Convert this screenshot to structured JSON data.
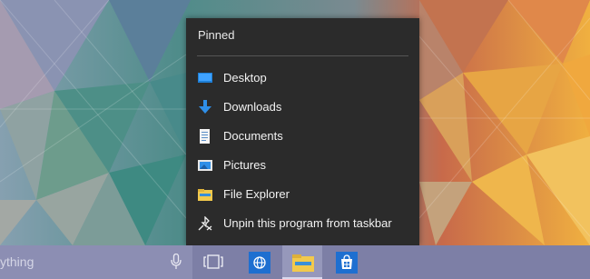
{
  "jumplist": {
    "header": "Pinned",
    "items": [
      {
        "label": "Desktop",
        "icon": "desktop-icon"
      },
      {
        "label": "Downloads",
        "icon": "downloads-icon"
      },
      {
        "label": "Documents",
        "icon": "documents-icon"
      },
      {
        "label": "Pictures",
        "icon": "pictures-icon"
      },
      {
        "label": "File Explorer",
        "icon": "file-explorer-icon"
      },
      {
        "label": "Unpin this program from taskbar",
        "icon": "unpin-icon"
      }
    ]
  },
  "taskbar": {
    "search_text": "ything",
    "buttons": [
      "task-view-icon",
      "edge-icon",
      "file-explorer-icon",
      "store-icon"
    ]
  },
  "colors": {
    "jumplist_bg": "#2b2b2b",
    "taskbar_bg": "#7d7fa6",
    "accent_blue": "#1e7fd6"
  }
}
